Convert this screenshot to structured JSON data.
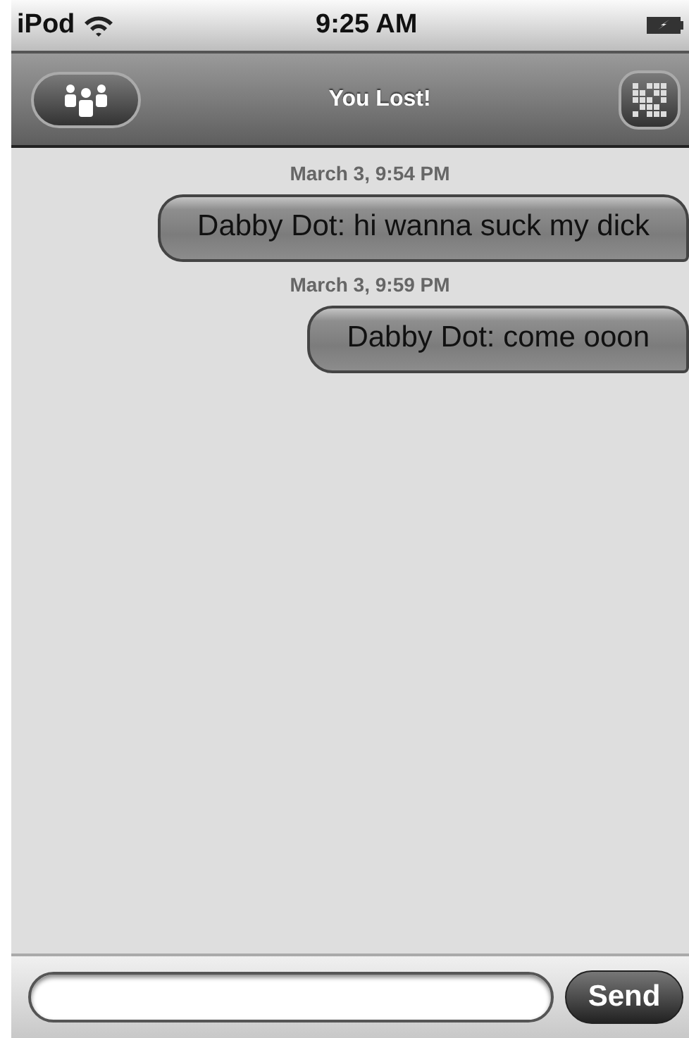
{
  "status_bar": {
    "device": "iPod",
    "time": "9:25 AM"
  },
  "nav_bar": {
    "title": "You Lost!"
  },
  "messages": [
    {
      "timestamp": "March 3, 9:54 PM",
      "text": "Dabby Dot: hi wanna suck my dick"
    },
    {
      "timestamp": "March 3, 9:59 PM",
      "text": "Dabby Dot: come ooon"
    }
  ],
  "compose": {
    "button": "Send"
  }
}
